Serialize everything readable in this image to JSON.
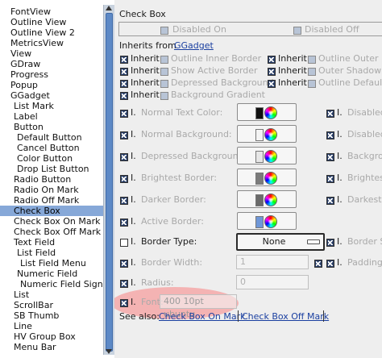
{
  "tree": {
    "items": [
      {
        "label": "FontView",
        "indent": 0
      },
      {
        "label": "Outline View",
        "indent": 0
      },
      {
        "label": "Outline View 2",
        "indent": 0
      },
      {
        "label": "MetricsView",
        "indent": 0
      },
      {
        "label": "View",
        "indent": 0
      },
      {
        "label": "GDraw",
        "indent": 0
      },
      {
        "label": "Progress",
        "indent": 0
      },
      {
        "label": "Popup",
        "indent": 0
      },
      {
        "label": "GGadget",
        "indent": 0
      },
      {
        "label": "List Mark",
        "indent": 1
      },
      {
        "label": "Label",
        "indent": 1
      },
      {
        "label": "Button",
        "indent": 1
      },
      {
        "label": "Default Button",
        "indent": 2
      },
      {
        "label": "Cancel Button",
        "indent": 2
      },
      {
        "label": "Color Button",
        "indent": 2
      },
      {
        "label": "Drop List Button",
        "indent": 2
      },
      {
        "label": "Radio Button",
        "indent": 1
      },
      {
        "label": "Radio On Mark",
        "indent": 1
      },
      {
        "label": "Radio Off Mark",
        "indent": 1
      },
      {
        "label": "Check Box",
        "indent": 1,
        "selected": true
      },
      {
        "label": "Check Box On Mark",
        "indent": 1
      },
      {
        "label": "Check Box Off Mark",
        "indent": 1
      },
      {
        "label": "Text Field",
        "indent": 1
      },
      {
        "label": "List Field",
        "indent": 2
      },
      {
        "label": "List Field Menu",
        "indent": 3
      },
      {
        "label": "Numeric Field",
        "indent": 2
      },
      {
        "label": "Numeric Field Sign",
        "indent": 3
      },
      {
        "label": "List",
        "indent": 1
      },
      {
        "label": "ScrollBar",
        "indent": 1
      },
      {
        "label": "SB Thumb",
        "indent": 1
      },
      {
        "label": "Line",
        "indent": 1
      },
      {
        "label": "HV Group Box",
        "indent": 1
      },
      {
        "label": "Menu Bar",
        "indent": 1
      }
    ]
  },
  "panel": {
    "section_title": "Check Box",
    "sample_disabled_on": "Disabled On",
    "sample_disabled_off": "Disabled Off",
    "inherits_from_label": "Inherits from",
    "inherits_from_value": "GGadget",
    "inherit_label": "Inherit",
    "inherit_items": [
      "Outline Inner Border",
      "Show Active Border",
      "Depressed Background",
      "Background Gradient",
      "Outline Outer Border",
      "Outer Shadow",
      "Outline Default Border"
    ],
    "inherit_short": "I.",
    "normal_text_color": "Normal Text Color:",
    "normal_background": "Normal Background:",
    "depressed_background": "Depressed Background:",
    "brightest_border": "Brightest Border:",
    "darker_border": "Darker Border:",
    "active_border": "Active Border:",
    "border_type": "Border Type:",
    "border_type_value": "None",
    "border_width": "Border Width:",
    "border_width_value": "1",
    "radius": "Radius:",
    "radius_value": "0",
    "font": "Font:",
    "font_value": "400 10pt ubuntu",
    "right_disabled": "Disabled",
    "right_background": "Backgrou",
    "right_brightest": "Brightest",
    "right_darkest": "Darkest E",
    "right_border_sh": "Border Sh",
    "right_padding": "Padding:",
    "see_also_label": "See also:",
    "see_also_links": [
      "Check Box On Mark",
      "Check Box Off Mark"
    ]
  },
  "colors": {
    "selection": "#86a8d8",
    "panel_bg": "#eeeeee",
    "link": "#1a3fa0",
    "highlight_ellipse": "#f4a8a8",
    "checkbox_fill": "#2a3f68",
    "scroll_thumb": "#5d89c6"
  },
  "swatches": {
    "normal_text": "#111111",
    "normal_background": "#f4f4f4",
    "depressed_background": "#e6e6e6",
    "brightest_border": "#7b7b7b",
    "darker_border": "#6a6a6a",
    "active_border": "#6f97d8"
  }
}
